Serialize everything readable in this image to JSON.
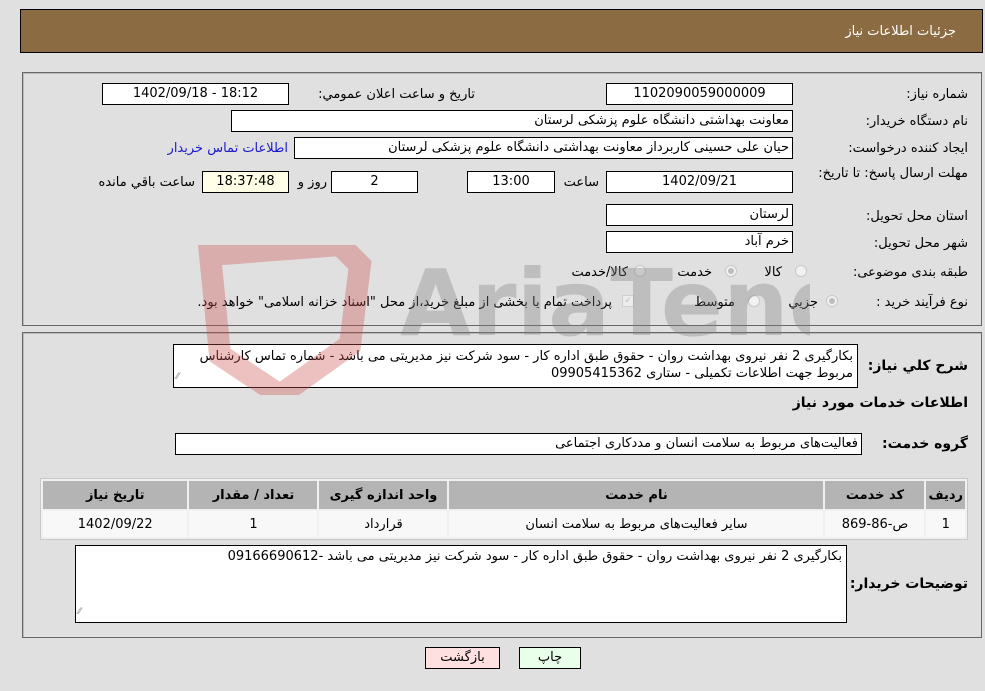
{
  "header": {
    "title": "جزئیات اطلاعات نیاز"
  },
  "fields": {
    "need_number_label": "شماره نیاز:",
    "need_number": "1102090059000009",
    "announce_label": "تاریخ و ساعت اعلان عمومي:",
    "announce_value": "1402/09/18 - 18:12",
    "buyer_org_label": "نام دستگاه خریدار:",
    "buyer_org": "معاونت بهداشتی دانشگاه علوم پزشکی لرستان",
    "creator_label": "ایجاد کننده درخواست:",
    "creator": "حیان علی حسینی کاربرداز معاونت بهداشتی دانشگاه علوم پزشکی لرستان",
    "contact_link": "اطلاعات تماس خریدار",
    "deadline_label": "مهلت ارسال پاسخ: تا تاریخ:",
    "deadline_date": "1402/09/21",
    "time_label": "ساعت",
    "deadline_time": "13:00",
    "days_value": "2",
    "days_label": "روز و",
    "remaining_time": "18:37:48",
    "remaining_label": "ساعت باقي مانده",
    "province_label": "استان محل تحویل:",
    "province": "لرستان",
    "city_label": "شهر محل تحویل:",
    "city": "خرم آباد",
    "category_label": "طبقه بندی موضوعی:",
    "category_options": [
      {
        "label": "کالا",
        "checked": false
      },
      {
        "label": "خدمت",
        "checked": true
      },
      {
        "label": "کالا/خدمت",
        "checked": false
      }
    ],
    "process_label": "نوع فرآیند خرید :",
    "process_options": [
      {
        "label": "جزيي",
        "checked": true
      },
      {
        "label": "متوسط",
        "checked": false
      }
    ],
    "treasury_note": "پرداخت تمام یا بخشی از مبلغ خرید،از محل \"اسناد خزانه اسلامی\" خواهد بود."
  },
  "description": {
    "label": "شرح کلي نیاز:",
    "text": "بکارگیری 2 نفر نیروی بهداشت روان - حقوق طبق اداره کار - سود شرکت نیز مدیریتی می باشد - شماره تماس کارشناس مربوط جهت اطلاعات تکمیلی - ستاری 09905415362"
  },
  "services": {
    "section_title": "اطلاعات خدمات مورد نیاز",
    "group_label": "گروه خدمت:",
    "group_value": "فعالیت‌های مربوط به سلامت انسان و مددکاری اجتماعی",
    "columns": [
      "ردیف",
      "کد خدمت",
      "نام خدمت",
      "واحد اندازه گیری",
      "تعداد / مقدار",
      "تاریخ نیاز"
    ],
    "rows": [
      [
        "1",
        "ص-86-869",
        "سایر فعالیت‌های مربوط به سلامت انسان",
        "قرارداد",
        "1",
        "1402/09/22"
      ]
    ]
  },
  "buyer_notes": {
    "label": "توضیحات خریدار:",
    "text": "بکارگیری 2 نفر نیروی بهداشت روان - حقوق طبق اداره کار - سود شرکت نیز مدیریتی می باشد -09166690612"
  },
  "buttons": {
    "print": "چاپ",
    "back": "بازگشت"
  },
  "watermark": {
    "text": "AriaTender.neT"
  },
  "colors": {
    "header_bg": "#8b6b42",
    "link": "#1a1acc",
    "print_bg": "#eaffea",
    "back_bg": "#ffe0e0"
  }
}
